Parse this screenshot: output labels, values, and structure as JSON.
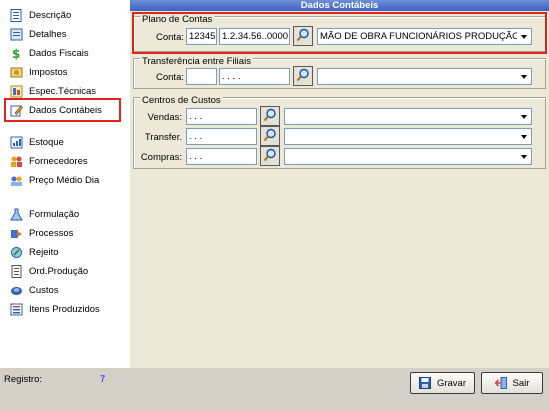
{
  "sidebar": {
    "items": [
      {
        "label": "Descrição",
        "icon": "document-icon"
      },
      {
        "label": "Detalhes",
        "icon": "details-icon"
      },
      {
        "label": "Dados Fiscais",
        "icon": "dollar-icon"
      },
      {
        "label": "Impostos",
        "icon": "tax-icon"
      },
      {
        "label": "Espec.Técnicas",
        "icon": "specs-icon"
      },
      {
        "label": "Dados Contábeis",
        "icon": "pencil-icon",
        "selected": true
      },
      {
        "label": "Estoque",
        "icon": "stock-icon"
      },
      {
        "label": "Fornecedores",
        "icon": "suppliers-icon"
      },
      {
        "label": "Preço Médio Dia",
        "icon": "price-icon"
      },
      {
        "label": "Formulação",
        "icon": "flask-icon"
      },
      {
        "label": "Processos",
        "icon": "process-icon"
      },
      {
        "label": "Rejeito",
        "icon": "reject-icon"
      },
      {
        "label": "Ord.Produção",
        "icon": "order-icon"
      },
      {
        "label": "Custos",
        "icon": "costs-icon"
      },
      {
        "label": "Itens Produzidos",
        "icon": "items-icon"
      }
    ]
  },
  "footer": {
    "registro_label": "Registro:",
    "registro_value": "7",
    "save_label": "Gravar",
    "exit_label": "Sair"
  },
  "panel": {
    "title": "Dados Contábeis",
    "plano": {
      "group_label": "Plano de Contas",
      "conta_label": "Conta:",
      "code": "12345",
      "account": "1.2.34.56..0000",
      "description": "MÃO DE OBRA FUNCIONÁRIOS PRODUÇÃO"
    },
    "transferencia": {
      "group_label": "Transferência entre Filiais",
      "conta_label": "Conta:",
      "code": "",
      "account": ". . . .",
      "description": ""
    },
    "centros": {
      "group_label": "Centros de Custos",
      "rows": [
        {
          "label": "Vendas:",
          "value": ". . .",
          "description": ""
        },
        {
          "label": "Transfer.",
          "value": ". . .",
          "description": ""
        },
        {
          "label": "Compras:",
          "value": ". . .",
          "description": ""
        }
      ]
    }
  },
  "colors": {
    "highlight": "#e0241c",
    "title_bar": "#3c62c0",
    "registro_value": "#0000ff"
  }
}
